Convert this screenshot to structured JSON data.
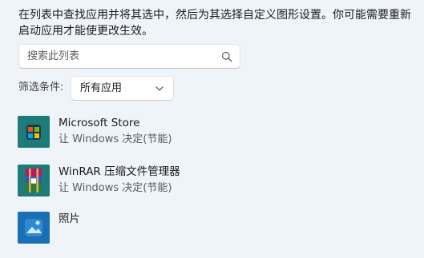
{
  "description": "在列表中查找应用并将其选中，然后为其选择自定义图形设置。你可能需要重新启动应用才能使更改生效。",
  "search": {
    "placeholder": "搜索此列表",
    "icon": "search-icon"
  },
  "filter": {
    "label": "筛选条件:",
    "selected": "所有应用",
    "icon": "chevron-down-icon"
  },
  "apps": [
    {
      "name": "Microsoft Store",
      "setting": "让 Windows 决定(节能)",
      "icon": "microsoft-store-icon"
    },
    {
      "name": "WinRAR 压缩文件管理器",
      "setting": "让 Windows 决定(节能)",
      "icon": "winrar-icon"
    },
    {
      "name": "照片",
      "setting": "",
      "icon": "photos-icon"
    }
  ],
  "colors": {
    "background": "#eff4f9",
    "store_tile": "#1f7a7a",
    "photos_tile": "#1b6fb5"
  }
}
